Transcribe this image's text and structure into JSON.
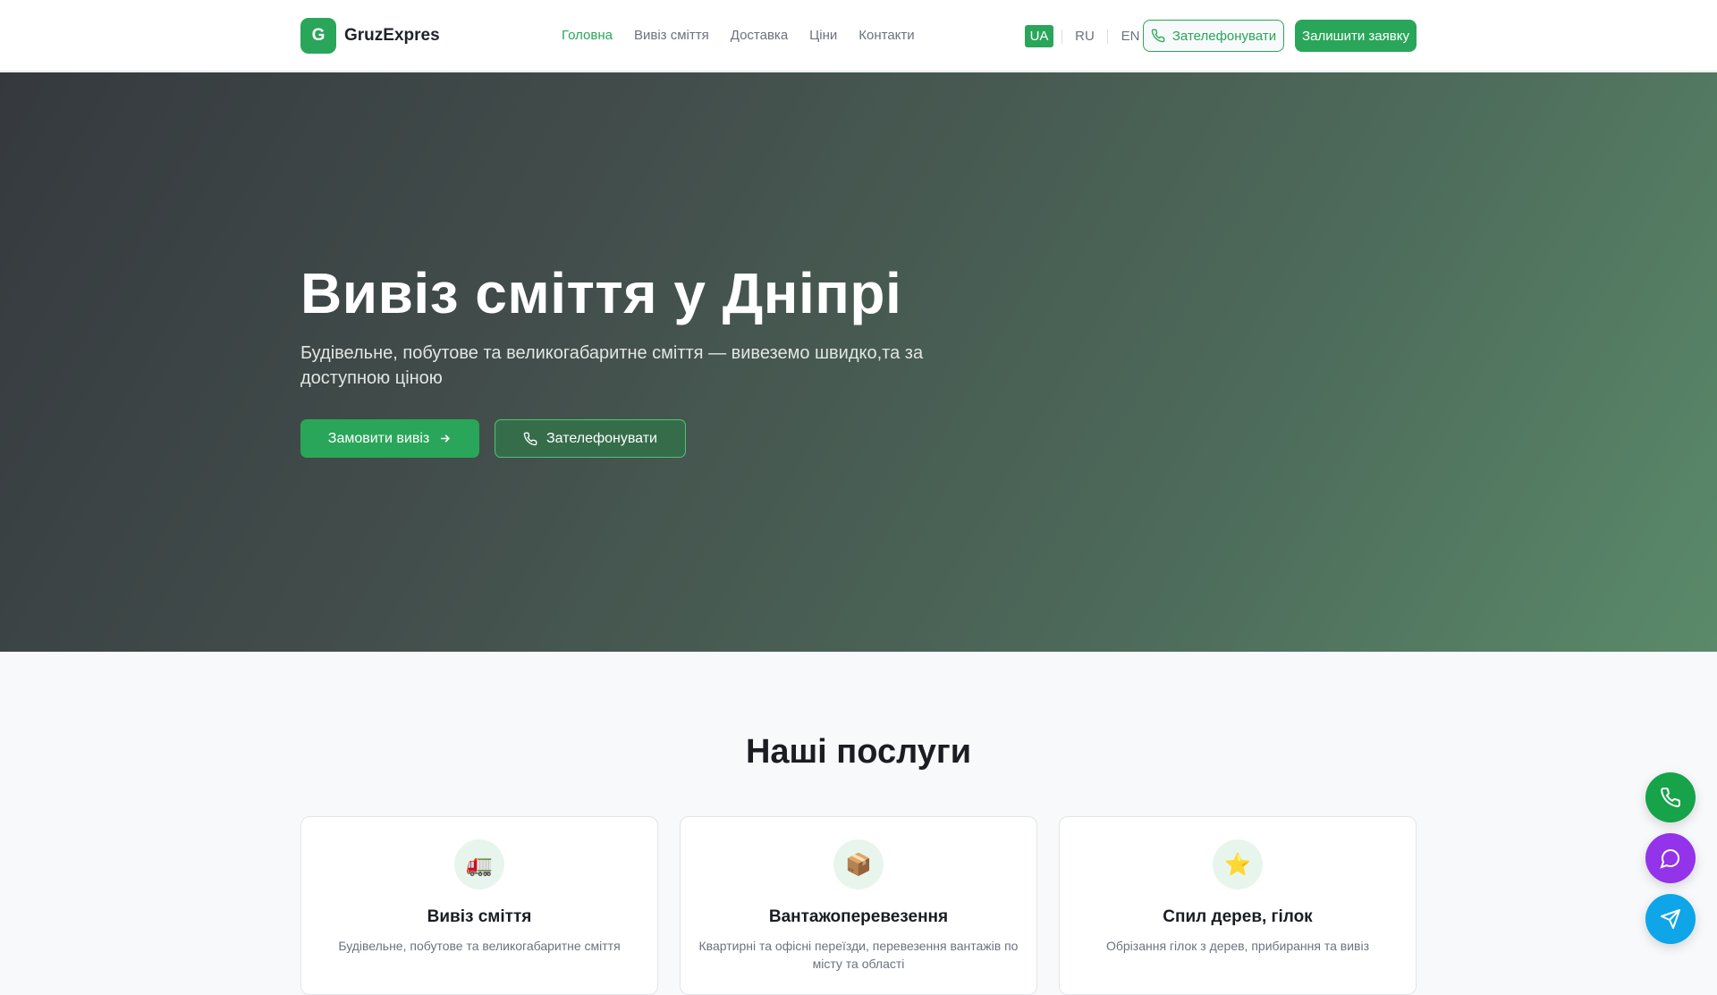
{
  "header": {
    "logo_letter": "G",
    "logo_text": "GruzExpres",
    "nav": [
      {
        "label": "Головна",
        "active": true
      },
      {
        "label": "Вивіз сміття"
      },
      {
        "label": "Доставка"
      },
      {
        "label": "Ціни"
      },
      {
        "label": "Контакти"
      }
    ],
    "languages": [
      "UA",
      "RU",
      "EN"
    ],
    "active_language": "UA",
    "call_label": "Зателефонувати",
    "request_label": "Залишити заявку"
  },
  "hero": {
    "title": "Вивіз сміття у Дніпрі",
    "subtitle": "Будівельне, побутове та великогабаритне сміття — вивеземо швидко,та за доступною ціною",
    "order_label": "Замовити вивіз",
    "call_label": "Зателефонувати"
  },
  "services": {
    "title": "Наші послуги",
    "items": [
      {
        "icon": "🚛",
        "title": "Вивіз сміття",
        "desc": "Будівельне, побутове та великогабаритне сміття"
      },
      {
        "icon": "📦",
        "title": "Вантажоперевезення",
        "desc": "Квартирні та офісні переїзди, перевезення вантажів по місту та області"
      },
      {
        "icon": "⭐",
        "title": "Спил дерев, гілок",
        "desc": "Обрізання гілок з дерев, прибирання та вивіз"
      }
    ]
  },
  "colors": {
    "accent": "#2aa65a",
    "viber": "#9333ea",
    "telegram": "#0ea5e9",
    "phone": "#16a34a"
  }
}
